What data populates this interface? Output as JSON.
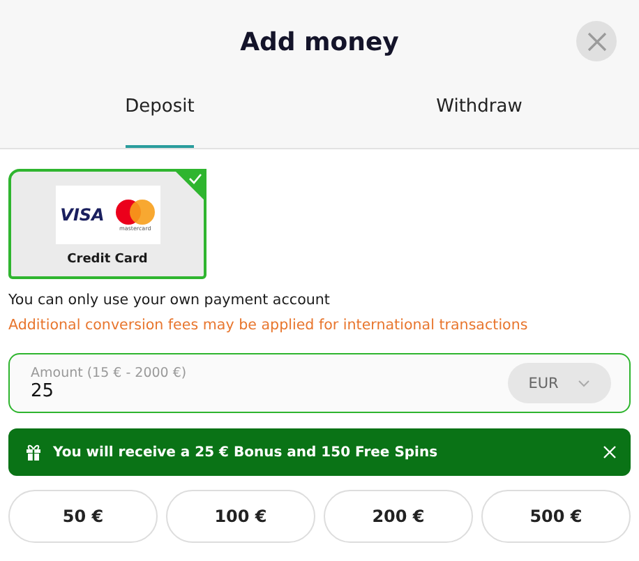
{
  "title": "Add money",
  "tabs": [
    {
      "label": "Deposit",
      "selected": true
    },
    {
      "label": "Withdraw",
      "selected": false
    }
  ],
  "methods": [
    {
      "brand_text": "VISA",
      "brand_small": "mastercard",
      "label": "Credit Card",
      "selected": true
    }
  ],
  "notes": [
    {
      "text": "You can only use your own payment account",
      "kind": "info"
    },
    {
      "text": "Additional conversion fees may be applied for international transactions",
      "kind": "warning"
    }
  ],
  "amount": {
    "label": "Amount (15 € - 2000 €)",
    "value": "25",
    "currency": "EUR"
  },
  "bonus_banner": {
    "text": "You will receive a 25 € Bonus and 150 Free Spins"
  },
  "presets": [
    "50 €",
    "100 €",
    "200 €",
    "500 €"
  ]
}
